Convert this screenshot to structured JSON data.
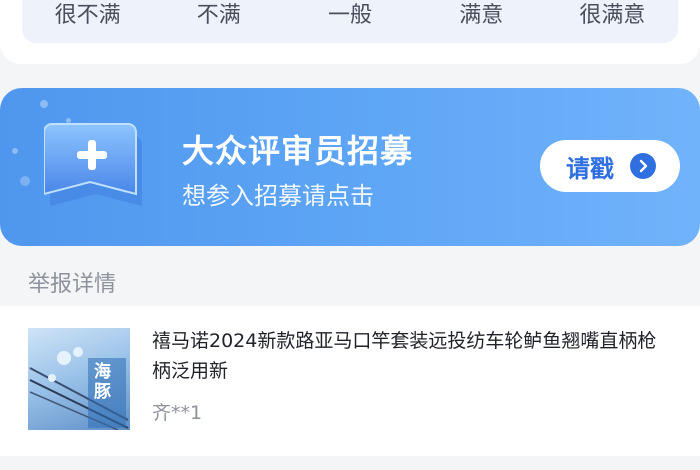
{
  "rating": {
    "options": [
      "很不满",
      "不满",
      "一般",
      "满意",
      "很满意"
    ]
  },
  "banner": {
    "title": "大众评审员招募",
    "subtitle": "想参入招募请点击",
    "cta_label": "请戳"
  },
  "report": {
    "section_title": "举报详情",
    "product_title": "禧马诺2024新款路亚马口竿套装远投纺车轮鲈鱼翘嘴直柄枪柄泛用新",
    "user": "齐**1",
    "thumbnail_text": "海豚"
  },
  "colors": {
    "banner_gradient_start": "#4f97ee",
    "banner_gradient_end": "#71b3fb",
    "cta_text": "#2f6fe0",
    "background": "#f4f5f7"
  }
}
